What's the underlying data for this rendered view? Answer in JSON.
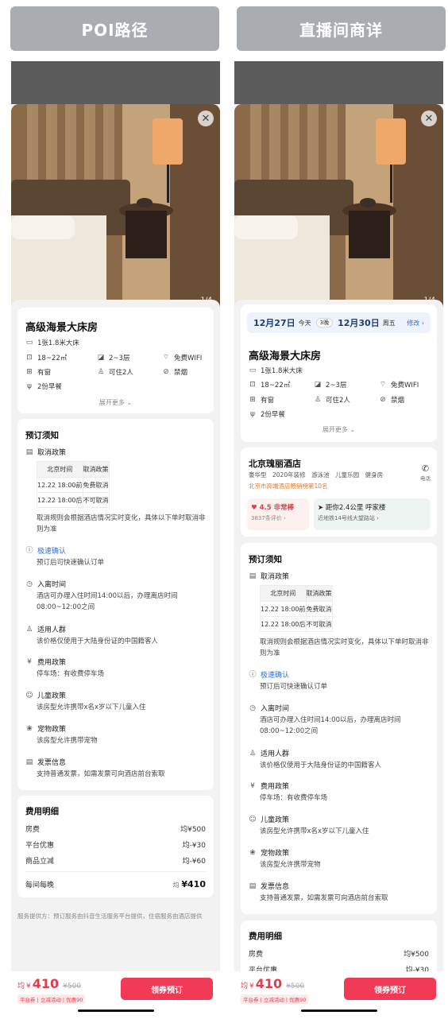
{
  "headers": {
    "left": "POI路径",
    "right": "直播间商详"
  },
  "photo": {
    "pager": "1/4",
    "close": "✕"
  },
  "date": {
    "checkin": "12月27日",
    "checkin_day": "今天",
    "nights": "3晚",
    "checkout": "12月30日",
    "checkout_day": "周五",
    "edit": "修改 ›"
  },
  "room": {
    "title": "高级海景大床房",
    "bed": "1张1.8米大床",
    "area": "18~22㎡",
    "floor": "2~3层",
    "wifi": "免费WIFI",
    "window": "有窗",
    "guests": "可住2人",
    "smoke": "禁烟",
    "breakfast": "2份早餐",
    "more": "展开更多 ⌄"
  },
  "hotel": {
    "name": "北京瑰丽酒店",
    "tags": "豪华型　2020年装修　游泳池　儿童乐园　健身房",
    "rank": "北京市高端酒店畅销榜第10名",
    "phone": "电话",
    "rating": "4.5 非常棒",
    "reviews": "3837条评价 ›",
    "distance": "距你2.4公里 呼家楼",
    "metro": "近地铁14号线大望路站 ›"
  },
  "notice": {
    "title": "预订须知",
    "cancel_title": "取消政策",
    "table_head": [
      "北京时间",
      "取消政策"
    ],
    "table_rows": [
      [
        "12.22 18:00前",
        "免费取消"
      ],
      [
        "12.22 18:00后",
        "不可取消"
      ]
    ],
    "cancel_note": "取消规则会根据酒店情况实时变化，具体以下单时取消非则为准",
    "fast_title": "极速确认",
    "fast_text": "预订后可快速确认订单",
    "checkin_title": "入离时间",
    "checkin_text": "酒店可办理入住时间14:00以后，办理离店时间08:00~12:00之间",
    "people_title": "适用人群",
    "people_text": "该价格仅使用于大陆身份证的中国籍客人",
    "fee_title": "费用政策",
    "fee_text": "停车场：有收费停车场",
    "child_title": "儿童政策",
    "child_text": "该房型允许携带x名x岁以下儿童入住",
    "pet_title": "宠物政策",
    "pet_text": "该房型允许携带宠物",
    "invoice_title": "发票信息",
    "invoice_text": "支持普通发票，如需发票可向酒店前台索取"
  },
  "fees": {
    "title": "费用明细",
    "rows": [
      [
        "房费",
        "均¥500"
      ],
      [
        "平台优惠",
        "均-¥30"
      ],
      [
        "商品立减",
        "均-¥60"
      ]
    ],
    "nightly_label": "每间每晚",
    "nightly_prefix": "均",
    "nightly_value": "¥410"
  },
  "provider": "服务提供方：预订服务由抖音生活服务平台提供，住宿服务由酒店提供",
  "bottom": {
    "prefix": "均",
    "currency": "¥",
    "price": "410",
    "original": "¥500",
    "tags": "平台券 | 立减活动 | 优惠90",
    "button": "领券预订"
  },
  "colors": {
    "accent": "#f23a56",
    "price": "#e23c4c",
    "link": "#2f6fd6"
  }
}
